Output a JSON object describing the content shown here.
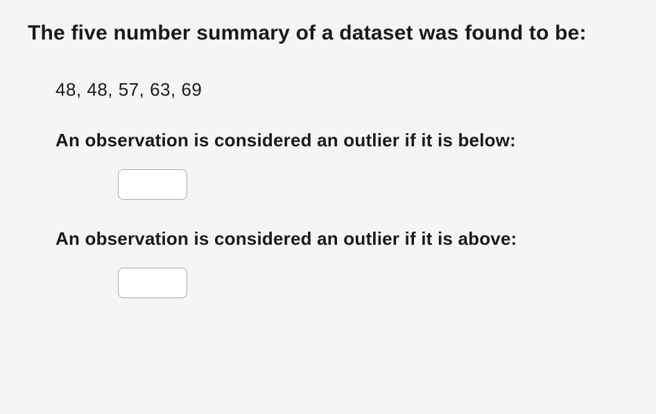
{
  "heading": "The five number summary of a dataset was found to be:",
  "five_number_summary": "48, 48, 57, 63, 69",
  "prompt_below": "An observation is considered an outlier if it is below:",
  "prompt_above": "An observation is considered an outlier if it is above:",
  "input_below_value": "",
  "input_above_value": ""
}
